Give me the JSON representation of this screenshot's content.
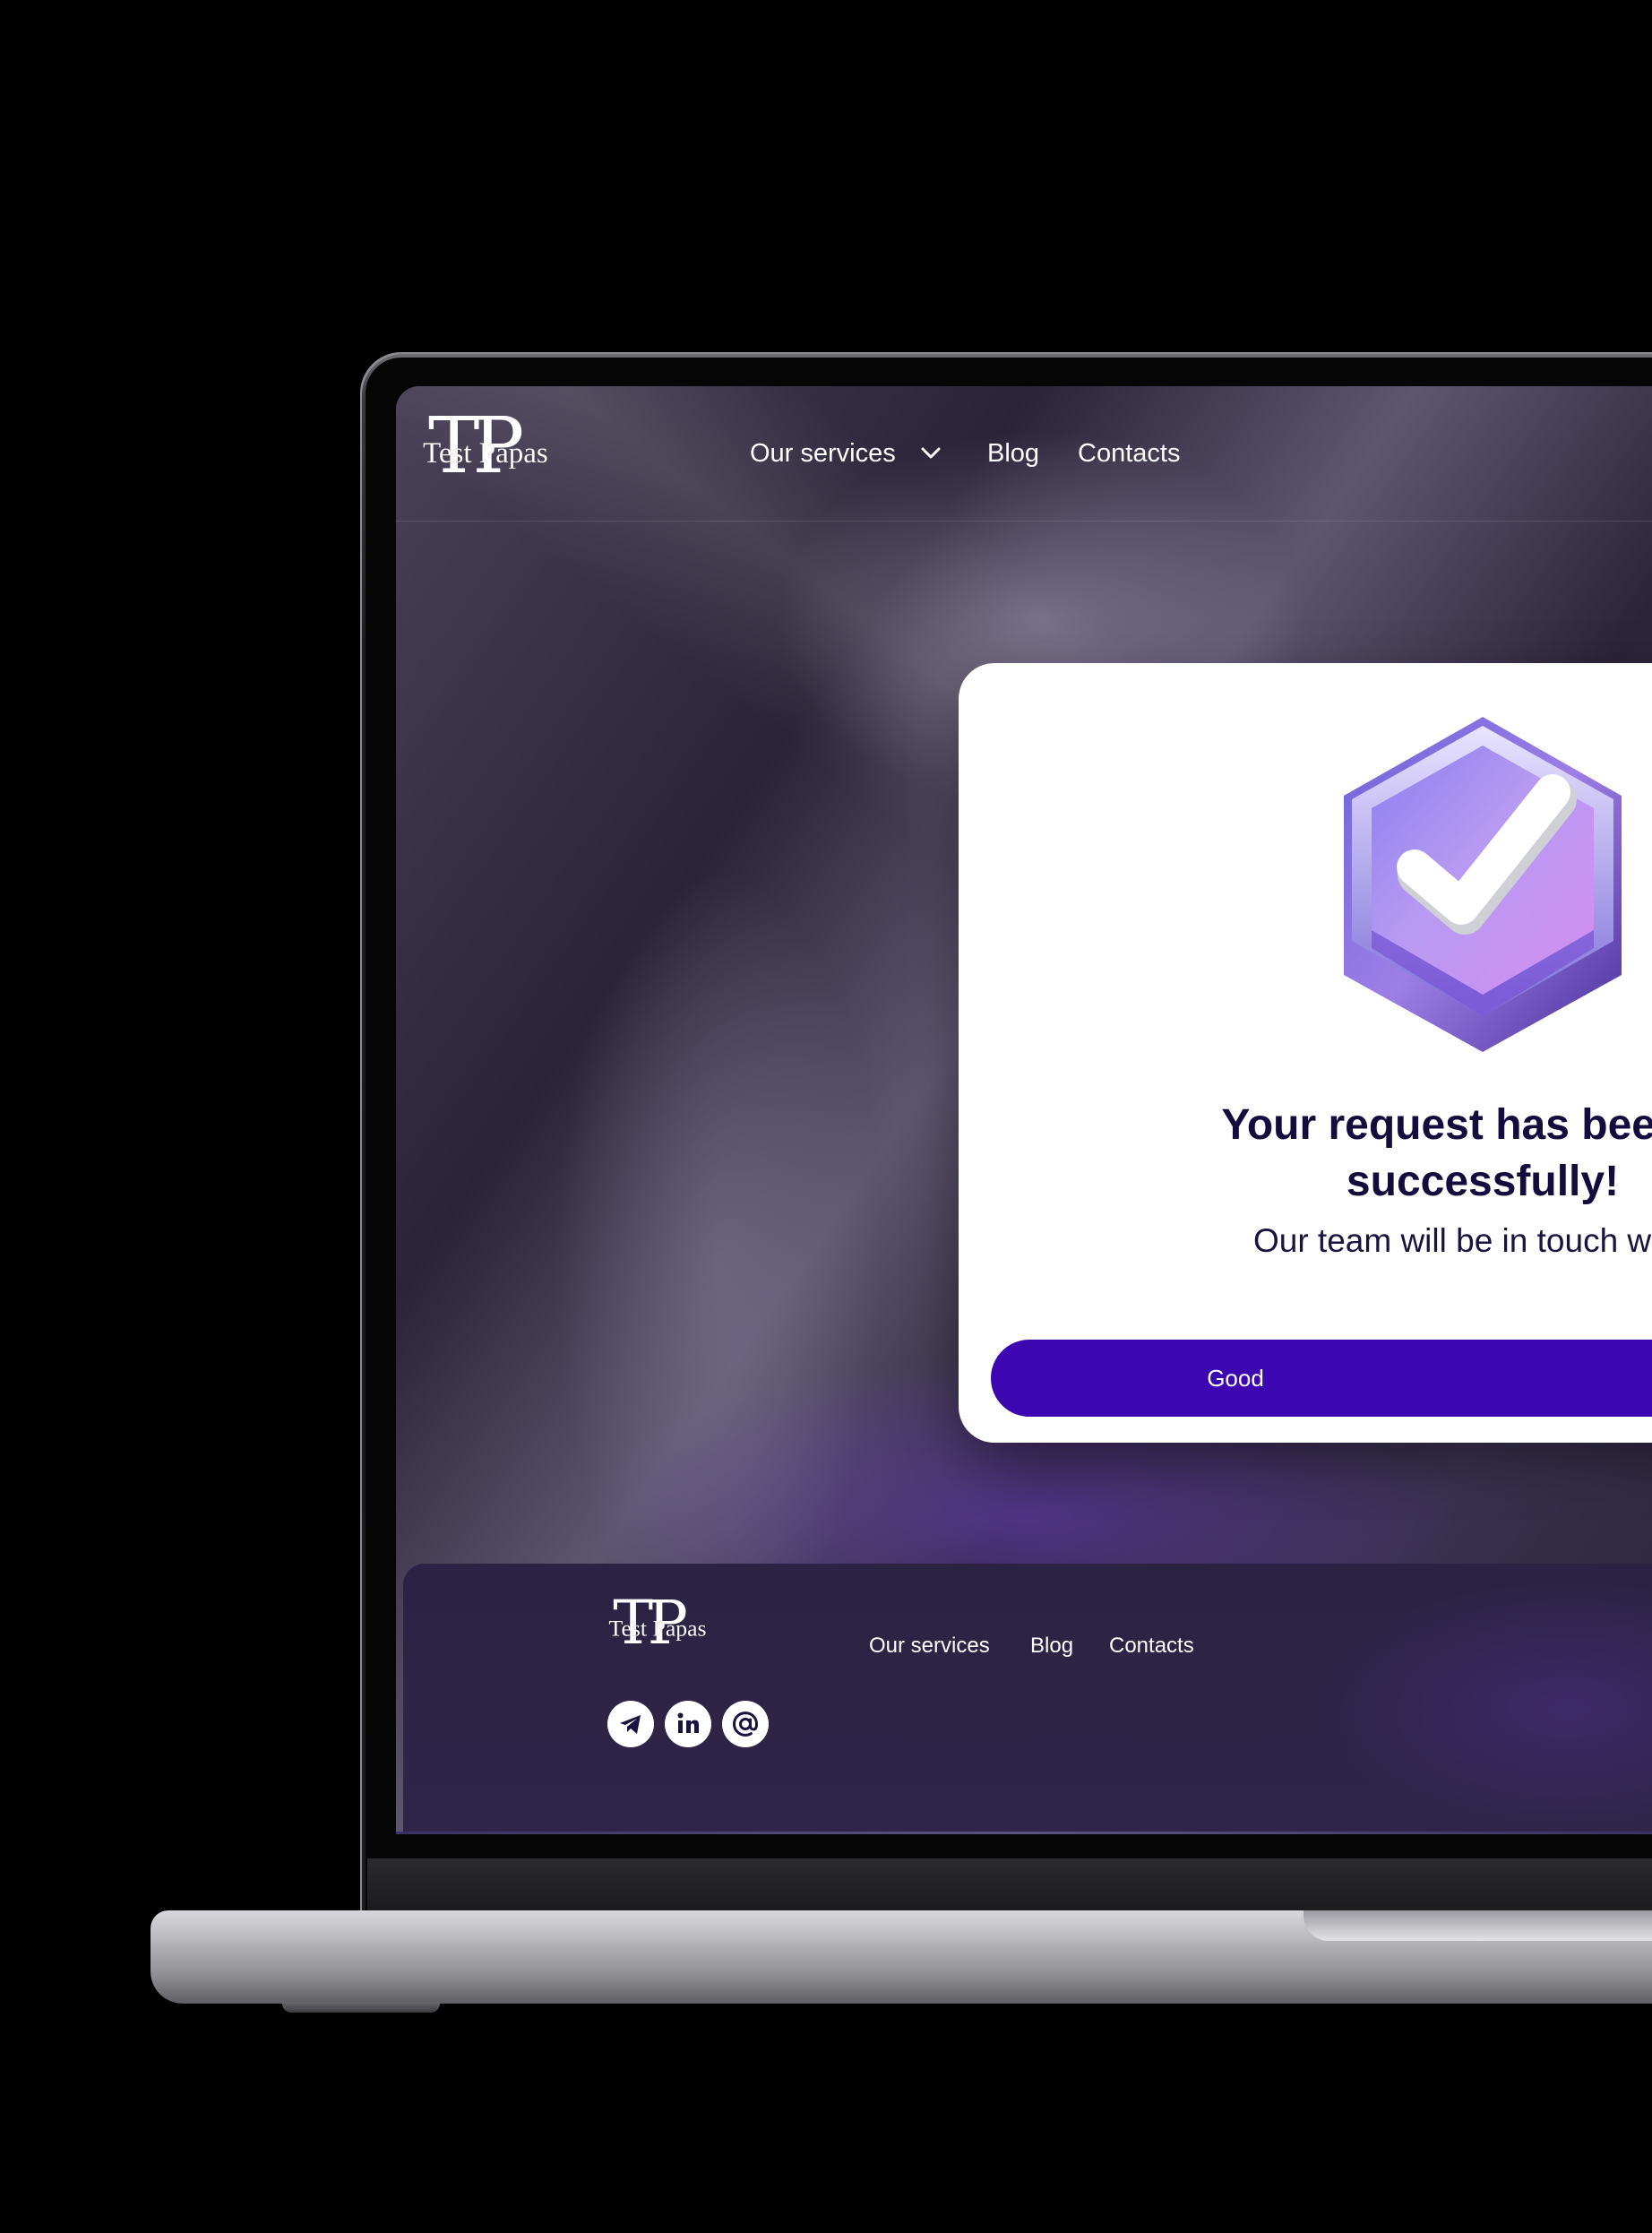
{
  "header": {
    "logo": {
      "monogram": "TP",
      "wordmark": "Test Papas"
    },
    "nav": [
      {
        "label": "Our services",
        "has_dropdown": true
      },
      {
        "label": "Blog"
      },
      {
        "label": "Contacts"
      }
    ]
  },
  "modal": {
    "icon": "check-badge-icon",
    "title_line1": "Your request has been su",
    "title_line2": "successfully!",
    "subtitle": "Our team will be in touch with y",
    "button_label": "Good"
  },
  "footer": {
    "logo": {
      "monogram": "TP",
      "wordmark": "Test Papas"
    },
    "links": [
      {
        "label": "Our services"
      },
      {
        "label": "Blog"
      },
      {
        "label": "Contacts"
      }
    ],
    "socials": [
      {
        "icon": "telegram-icon"
      },
      {
        "icon": "linkedin-icon"
      },
      {
        "icon": "email-icon"
      }
    ]
  },
  "colors": {
    "accent": "#3c07b0",
    "title": "#130c3c",
    "screen_bg": "#2a2336",
    "footer_bg": "#2c2344"
  }
}
